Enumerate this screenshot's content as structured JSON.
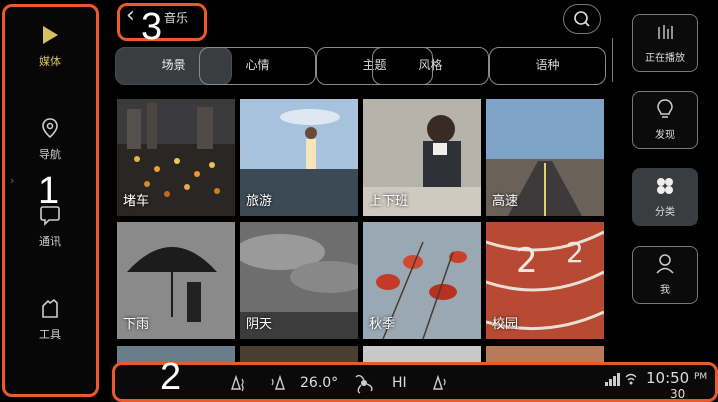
{
  "left_nav": {
    "items": [
      {
        "label": "媒体",
        "icon": "play-icon",
        "active": true
      },
      {
        "label": "导航",
        "icon": "location-pin-icon",
        "active": false
      },
      {
        "label": "通讯",
        "icon": "chat-bubble-icon",
        "active": false
      },
      {
        "label": "工具",
        "icon": "tools-icon",
        "active": false
      }
    ]
  },
  "header": {
    "back_label": "音乐",
    "search_icon": "search-icon"
  },
  "tabs": [
    {
      "label": "场景",
      "active": true
    },
    {
      "label": "心情",
      "active": false
    },
    {
      "label": "主题",
      "active": false
    },
    {
      "label": "风格",
      "active": false
    },
    {
      "label": "语种",
      "active": false
    }
  ],
  "tiles": [
    {
      "caption": "堵车"
    },
    {
      "caption": "旅游"
    },
    {
      "caption": "上下班"
    },
    {
      "caption": "高速"
    },
    {
      "caption": "下雨"
    },
    {
      "caption": "阴天"
    },
    {
      "caption": "秋季"
    },
    {
      "caption": "校园"
    }
  ],
  "right_panel": [
    {
      "label": "正在播放",
      "icon": "equalizer-icon",
      "active": false
    },
    {
      "label": "发现",
      "icon": "lightbulb-icon",
      "active": false
    },
    {
      "label": "分类",
      "icon": "category-icon",
      "active": true
    },
    {
      "label": "我",
      "icon": "user-icon",
      "active": false
    }
  ],
  "bottom_bar": {
    "temperature": "26.0°",
    "fan": "HI",
    "time": "10:50",
    "ampm": "PM",
    "temp_outside": "30"
  },
  "annotations": [
    {
      "number": "1",
      "color": "#ea5a2c"
    },
    {
      "number": "2",
      "color": "#ea5a2c"
    },
    {
      "number": "3",
      "color": "#ea5a2c"
    }
  ]
}
